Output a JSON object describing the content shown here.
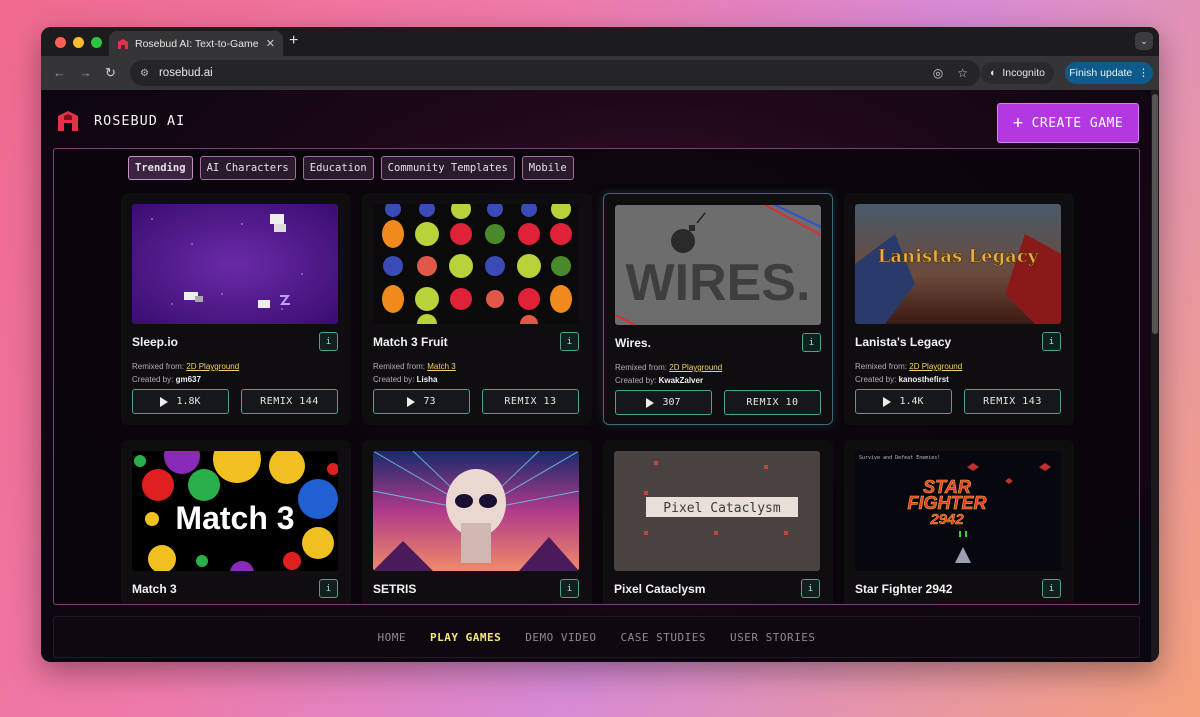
{
  "browser": {
    "tab_title": "Rosebud AI: Text-to-Game M",
    "url": "rosebud.ai",
    "incognito_label": "Incognito",
    "finish_update_label": "Finish update"
  },
  "header": {
    "brand_name": "ROSEBUD AI",
    "create_button": "CREATE GAME",
    "create_icon": "+"
  },
  "filters": [
    "Trending",
    "AI Characters",
    "Education",
    "Community Templates",
    "Mobile"
  ],
  "labels": {
    "remixed_from": "Remixed from:",
    "created_by": "Created by:",
    "info": "i",
    "remix": "REMIX"
  },
  "games": [
    {
      "title": "Sleep.io",
      "remixed_from": "2D Playground",
      "creator": "gm637",
      "plays": "1.8K",
      "remix_label": "REMIX 144"
    },
    {
      "title": "Match 3 Fruit",
      "remixed_from": "Match 3",
      "creator": "Lisha",
      "plays": "73",
      "remix_label": "REMIX 13"
    },
    {
      "title": "Wires.",
      "remixed_from": "2D Playground",
      "creator": "KwakZalver",
      "plays": "307",
      "remix_label": "REMIX 10"
    },
    {
      "title": "Lanista's Legacy",
      "remixed_from": "2D Playground",
      "creator": "kanosthefirst",
      "plays": "1.4K",
      "remix_label": "REMIX 143"
    },
    {
      "title": "Match 3"
    },
    {
      "title": "SETRIS"
    },
    {
      "title": "Pixel Cataclysm"
    },
    {
      "title": "Star Fighter 2942"
    }
  ],
  "thumb_text": {
    "wires": "WIRES.",
    "lanista": "Lanistas Legacy",
    "match3": "Match 3",
    "pixel": "Pixel Cataclysm",
    "star_top": "Survive and Defeat Enemies!",
    "star_line1": "STAR",
    "star_line2": "FIGHTER",
    "star_line3": "2942"
  },
  "footer_nav": [
    "HOME",
    "PLAY GAMES",
    "DEMO VIDEO",
    "CASE STUDIES",
    "USER STORIES"
  ],
  "footer_active": "PLAY GAMES",
  "colors": {
    "accent": "#b438e2",
    "card_border": "#4aa38e",
    "link": "#f1d26b"
  }
}
